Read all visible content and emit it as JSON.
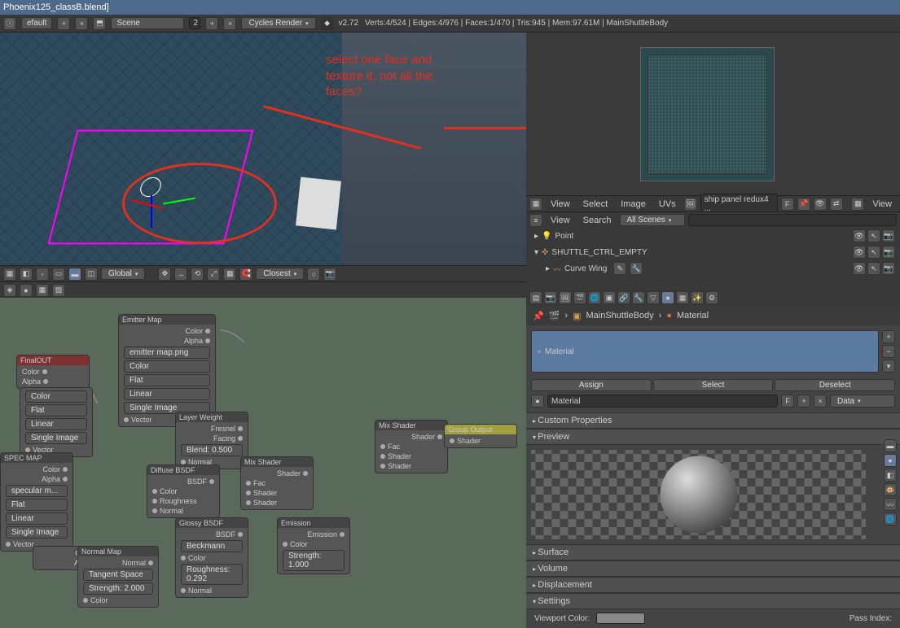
{
  "window_title": "Phoenix125_classB.blend]",
  "infobar": {
    "layout": "efault",
    "scene": "Scene",
    "scene_count": "2",
    "engine": "Cycles Render",
    "version": "v2.72",
    "stats": "Verts:4/524 | Edges:4/976 | Faces:1/470 | Tris:945 | Mem:97.61M | MainShuttleBody"
  },
  "annotation": "select one face and\ntexture it, not all the\nfaces?",
  "viewport": {
    "mode": "Global",
    "snap": "Closest"
  },
  "uv_editor": {
    "menus": [
      "View",
      "Select",
      "Image",
      "UVs"
    ],
    "image_name": "ship panel redux4 ...",
    "fake_user": "F",
    "side_menu": "View"
  },
  "outliner": {
    "menus": [
      "View",
      "Search"
    ],
    "filter": "All Scenes",
    "items": [
      {
        "name": "Point",
        "icon": "lamp"
      },
      {
        "name": "SHUTTLE_CTRL_EMPTY",
        "icon": "empty"
      },
      {
        "name": "Curve Wing",
        "icon": "curve"
      }
    ]
  },
  "properties": {
    "breadcrumb_obj": "MainShuttleBody",
    "breadcrumb_mat": "Material",
    "material_name": "Material",
    "fake_user": "F",
    "data_link": "Data",
    "buttons": {
      "assign": "Assign",
      "select": "Select",
      "deselect": "Deselect"
    },
    "panels": {
      "custom_props": "Custom Properties",
      "preview": "Preview",
      "surface": "Surface",
      "volume": "Volume",
      "displacement": "Displacement",
      "settings": "Settings"
    },
    "settings": {
      "viewport_color_label": "Viewport Color:",
      "pass_index_label": "Pass Index:"
    }
  },
  "nodes": {
    "final_out": "FinalOUT",
    "emitter_map": "Emitter Map",
    "emitter_file": "emitter map.png",
    "spec_map": "SPEC MAP",
    "spec_file": "specular m...",
    "normal_map": "Normal Map",
    "tangent": "Tangent Space",
    "strength": "Strength: 2.000",
    "layer_weight": "Layer Weight",
    "blend": "Blend: 0.500",
    "diffuse": "Diffuse BSDF",
    "glossy": "Glossy BSDF",
    "beckmann": "Beckmann",
    "roughless": "Roughness: 0.292",
    "mix1": "Mix Shader",
    "mix2": "Mix Shader",
    "emission": "Emission",
    "em_strength": "Strength: 1.000",
    "group_out": "Group Output",
    "sockets": {
      "color": "Color",
      "alpha": "Alpha",
      "vector": "Vector",
      "flat": "Flat",
      "linear": "Linear",
      "single": "Single Image",
      "roughness": "Roughness",
      "normal": "Normal",
      "bsdf": "BSDF",
      "fac": "Fac",
      "shader": "Shader",
      "fresnel": "Fresnel",
      "facing": "Facing",
      "emission": "Emission"
    }
  }
}
